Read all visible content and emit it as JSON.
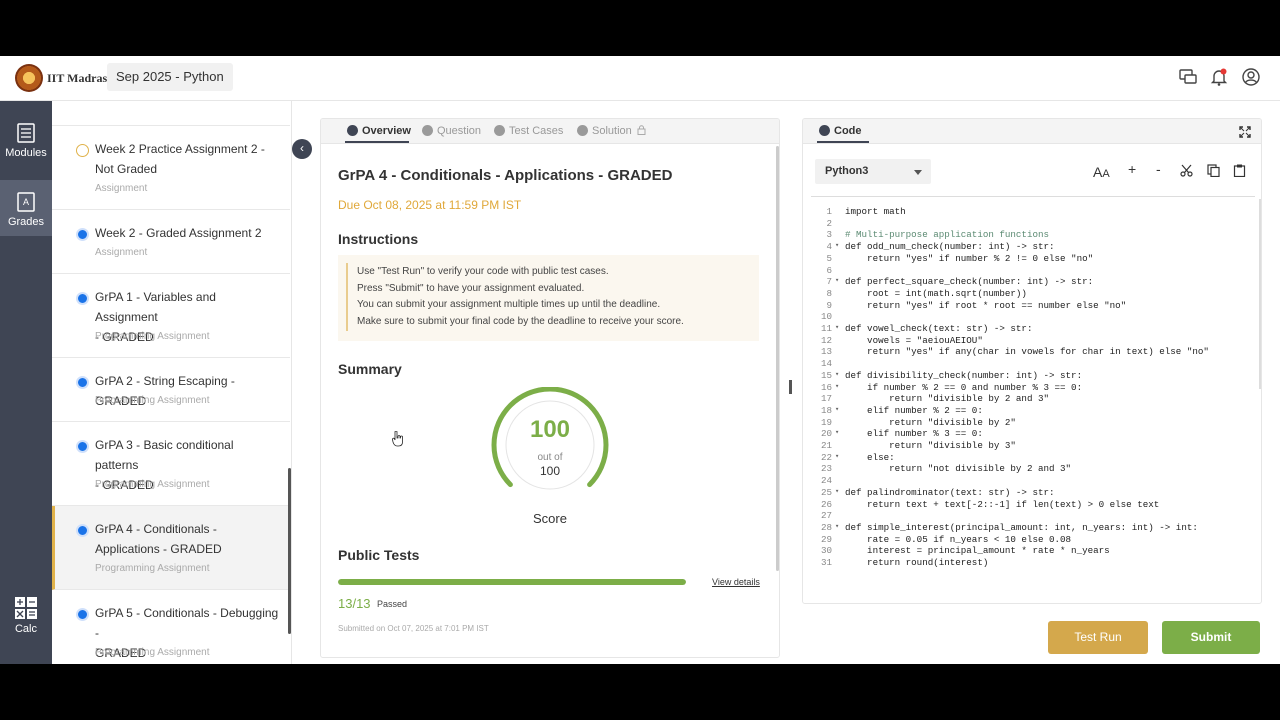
{
  "header": {
    "brand": "IIT Madras",
    "course": "Sep 2025 - Python",
    "icons": [
      "chat-icon",
      "bell-icon",
      "user-icon"
    ]
  },
  "rail": {
    "modules_label": "Modules",
    "grades_label": "Grades",
    "calc_label": "Calc"
  },
  "modules": [
    {
      "title_lines": [
        "Week 2 Practice Assignment 2 -",
        "Not Graded"
      ],
      "sub": "Assignment",
      "status": "clock"
    },
    {
      "title_lines": [
        "Week 2 - Graded Assignment 2"
      ],
      "sub": "Assignment",
      "status": "done"
    },
    {
      "title_lines": [
        "GrPA 1 - Variables and Assignment",
        "- GRADED"
      ],
      "sub": "Programming Assignment",
      "status": "done"
    },
    {
      "title_lines": [
        "GrPA 2 - String Escaping - GRADED"
      ],
      "sub": "Programming Assignment",
      "status": "done"
    },
    {
      "title_lines": [
        "GrPA 3 - Basic conditional patterns",
        "- GRADED"
      ],
      "sub": "Programming Assignment",
      "status": "done"
    },
    {
      "title_lines": [
        "GrPA 4 - Conditionals -",
        "Applications - GRADED"
      ],
      "sub": "Programming Assignment",
      "status": "done",
      "active": true
    },
    {
      "title_lines": [
        "GrPA 5 - Conditionals - Debugging -",
        "GRADED"
      ],
      "sub": "Programming Assignment",
      "status": "done"
    }
  ],
  "tabs": [
    "Overview",
    "Question",
    "Test Cases",
    "Solution"
  ],
  "overview": {
    "title": "GrPA 4 - Conditionals - Applications - GRADED",
    "due": "Due Oct 08, 2025 at 11:59 PM IST",
    "instructions_heading": "Instructions",
    "instructions": [
      "Use \"Test Run\" to verify your code with public test cases.",
      "Press \"Submit\" to have your assignment evaluated.",
      "You can submit your assignment multiple times up until the deadline.",
      "Make sure to submit your final code by the deadline to receive your score."
    ],
    "summary_heading": "Summary",
    "score": "100",
    "out_of": "out of",
    "max": "100",
    "score_fraction": 1.0,
    "score_label": "Score",
    "public_tests_heading": "Public Tests",
    "view_details": "View details",
    "passed": "13/13",
    "passed_fraction": 1.0,
    "passed_label": "Passed",
    "submitted": "Submitted on Oct 07, 2025 at 7:01 PM IST"
  },
  "editor": {
    "tab_label": "Code",
    "language": "Python3",
    "tools": [
      "A A",
      "+",
      "-"
    ],
    "lines": [
      "import math",
      "",
      "# Multi-purpose application functions",
      "def odd_num_check(number: int) -> str:",
      "    return \"yes\" if number % 2 != 0 else \"no\"",
      "",
      "def perfect_square_check(number: int) -> str:",
      "    root = int(math.sqrt(number))",
      "    return \"yes\" if root * root == number else \"no\"",
      "",
      "def vowel_check(text: str) -> str:",
      "    vowels = \"aeiouAEIOU\"",
      "    return \"yes\" if any(char in vowels for char in text) else \"no\"",
      "",
      "def divisibility_check(number: int) -> str:",
      "    if number % 2 == 0 and number % 3 == 0:",
      "        return \"divisible by 2 and 3\"",
      "    elif number % 2 == 0:",
      "        return \"divisible by 2\"",
      "    elif number % 3 == 0:",
      "        return \"divisible by 3\"",
      "    else:",
      "        return \"not divisible by 2 and 3\"",
      "",
      "def palindrominator(text: str) -> str:",
      "    return text + text[-2::-1] if len(text) > 0 else text",
      "",
      "def simple_interest(principal_amount: int, n_years: int) -> int:",
      "    rate = 0.05 if n_years < 10 else 0.08",
      "    interest = principal_amount * rate * n_years",
      "    return round(interest)"
    ],
    "fold_lines": [
      4,
      7,
      11,
      15,
      16,
      18,
      20,
      22,
      25,
      28
    ]
  },
  "buttons": {
    "test_run": "Test Run",
    "submit": "Submit"
  }
}
